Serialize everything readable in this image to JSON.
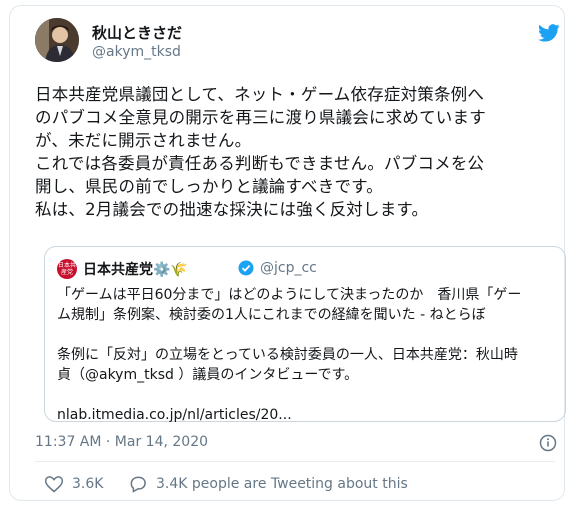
{
  "user": {
    "name": "秋山ときさだ",
    "handle": "@akym_tksd"
  },
  "tweet": {
    "text": "日本共産党県議団として、ネット・ゲーム依存症対策条例へ\nのパブコメ全意見の開示を再三に渡り県議会に求めています\nが、未だに開示されません。\nこれでは各委員が責任ある判断もできません。パブコメを公\n開し、県民の前でしっかりと議論すべきです。\n私は、2月議会での拙速な採決には強く反対します。",
    "timestamp": "11:37 AM · Mar 14, 2020",
    "like_count": "3.6K",
    "talking_text": "3.4K people are Tweeting about this"
  },
  "quoted": {
    "logo_text": "日本共産党",
    "name": "日本共産党⚙️🌾",
    "handle": "@jcp_cc",
    "text": "「ゲームは平日60分まで」はどのようにして決まったのか　香川県「ゲー\nム規制」条例案、検討委の1人にこれまでの経緯を聞いた - ねとらぼ\n\n条例に「反対」の立場をとっている検討委員の一人、日本共産党：秋山時\n貞（@akym_tksd ）議員のインタビューです。\n\nnlab.itmedia.co.jp/nl/articles/20..."
  },
  "colors": {
    "twitter_blue": "#1da1f2",
    "secondary_text": "#657786",
    "border": "#e1e8ed",
    "jcp_red": "#c8102e"
  },
  "icons": [
    "twitter-bird-icon",
    "verified-badge-icon",
    "info-icon",
    "heart-icon",
    "speech-bubble-icon"
  ]
}
